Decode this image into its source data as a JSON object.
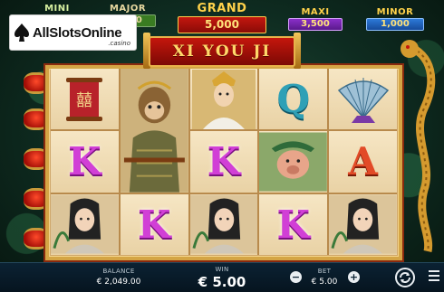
{
  "jackpots": {
    "mini": {
      "name": "MINI",
      "value": ""
    },
    "major": {
      "name": "MAJOR",
      "value": "2,500"
    },
    "grand": {
      "name": "GRAND",
      "value": "5,000"
    },
    "maxi": {
      "name": "MAXI",
      "value": "3,500"
    },
    "minor": {
      "name": "MINOR",
      "value": "1,000"
    }
  },
  "logo": {
    "brand": "AllSlotsOnline",
    "sub": ".casino"
  },
  "game": {
    "title": "XI YOU JI"
  },
  "reels": [
    [
      "lantern-scroll-symbol",
      "k-letter",
      "young-woman-symbol"
    ],
    [
      "monkey-king-symbol",
      "monkey-king-symbol",
      "k-letter"
    ],
    [
      "monk-symbol",
      "k-letter",
      "young-woman-symbol"
    ],
    [
      "q-letter",
      "pigsy-symbol",
      "k-letter"
    ],
    [
      "fan-symbol",
      "a-letter",
      "young-woman-symbol"
    ]
  ],
  "letters": {
    "k": "K",
    "q": "Q",
    "a": "A"
  },
  "bottom_bar": {
    "balance_label": "BALANCE",
    "balance_value": "€ 2,049.00",
    "win_label": "WIN",
    "win_value": "€ 5.00",
    "bet_label": "BET",
    "bet_value": "€ 5.00",
    "minus": "−",
    "plus": "+"
  },
  "colors": {
    "frame_gold": "#d4a545",
    "banner_red": "#c4160c",
    "letter_k": "#d13fd6",
    "letter_q": "#2fa0b6",
    "letter_a": "#e24a27"
  }
}
